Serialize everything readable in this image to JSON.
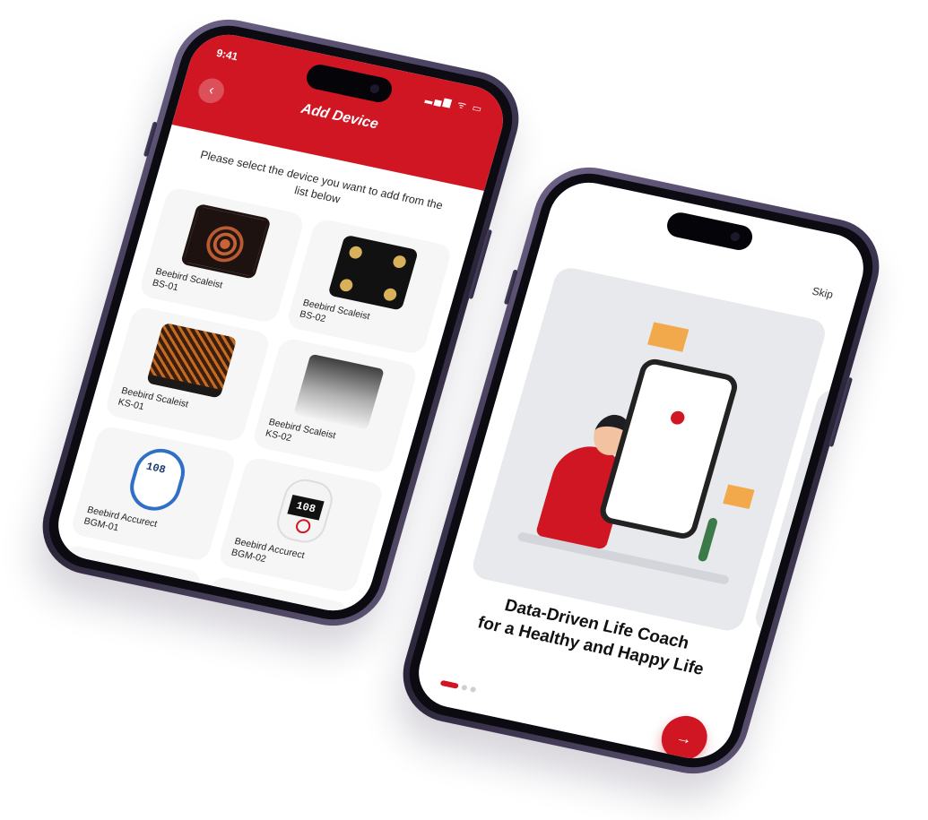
{
  "add_device_screen": {
    "status_time": "9:41",
    "status_icons": "▂▄▆ ᯤ ▭",
    "back_glyph": "‹",
    "title": "Add Device",
    "instructions": "Please select the device you want to add from the list below",
    "devices": [
      {
        "name": "Beebird Scaleist",
        "model": "BS-01"
      },
      {
        "name": "Beebird Scaleist",
        "model": "BS-02"
      },
      {
        "name": "Beebird Scaleist",
        "model": "KS-01"
      },
      {
        "name": "Beebird Scaleist",
        "model": "KS-02"
      },
      {
        "name": "Beebird Accurect",
        "model": "BGM-01"
      },
      {
        "name": "Beebird Accurect",
        "model": "BGM-02"
      }
    ]
  },
  "onboarding_screen": {
    "skip_label": "Skip",
    "headline_line1": "Data-Driven Life Coach",
    "headline_line2": "for a Healthy and Happy Life",
    "next_glyph": "→",
    "page_index": 1,
    "page_count": 3
  },
  "colors": {
    "brand_red": "#d01622",
    "card_bg": "#f6f6f7",
    "phone_frame": "#3b3450"
  }
}
